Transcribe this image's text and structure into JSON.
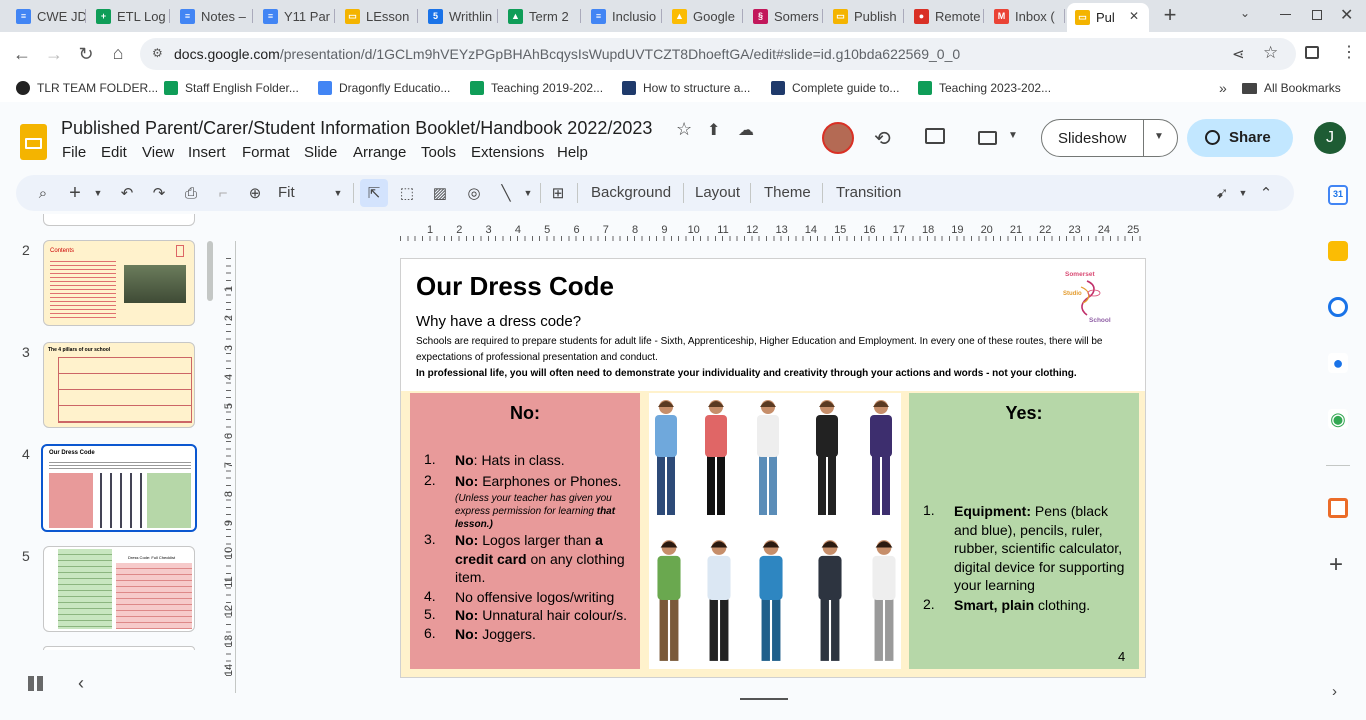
{
  "browser": {
    "tabs": [
      {
        "label": "CWE JD",
        "color": "#4285f4",
        "glyph": "≡"
      },
      {
        "label": "ETL Log",
        "color": "#0f9d58",
        "glyph": "+"
      },
      {
        "label": "Notes –",
        "color": "#4285f4",
        "glyph": "≡"
      },
      {
        "label": "Y11 Par",
        "color": "#4285f4",
        "glyph": "≡"
      },
      {
        "label": "LEsson",
        "color": "#f4b400",
        "glyph": "▭"
      },
      {
        "label": "Writhlin",
        "color": "#1a73e8",
        "glyph": "5"
      },
      {
        "label": "Term 2",
        "color": "#0f9d58",
        "glyph": "▲"
      },
      {
        "label": "Inclusio",
        "color": "#4285f4",
        "glyph": "≡"
      },
      {
        "label": "Google",
        "color": "#fbbc04",
        "glyph": "▲"
      },
      {
        "label": "Somers",
        "color": "#c2185b",
        "glyph": "§"
      },
      {
        "label": "Publish",
        "color": "#f4b400",
        "glyph": "▭"
      },
      {
        "label": "Remote",
        "color": "#d93025",
        "glyph": "●"
      },
      {
        "label": "Inbox (",
        "color": "#ea4335",
        "glyph": "M"
      },
      {
        "label": "Pul",
        "color": "#f4b400",
        "glyph": "▭"
      }
    ],
    "url_host": "docs.google.com",
    "url_path": "/presentation/d/1GCLm9hVEYzPGpBHAhBcqysIsWupdUVTCZT8DhoeftGA/edit#slide=id.g10bda622569_0_0",
    "bookmarks": [
      {
        "label": "TLR TEAM FOLDER...",
        "icon": "github-icon"
      },
      {
        "label": "Staff English Folder...",
        "icon": "drive-icon"
      },
      {
        "label": "Dragonfly Educatio...",
        "icon": "dragonfly-icon"
      },
      {
        "label": "Teaching 2019-202...",
        "icon": "drive-icon"
      },
      {
        "label": "How to structure a...",
        "icon": "tes-icon"
      },
      {
        "label": "Complete guide to...",
        "icon": "tes-icon"
      },
      {
        "label": "Teaching 2023-202...",
        "icon": "drive-icon"
      }
    ],
    "all_bookmarks": "All Bookmarks"
  },
  "app": {
    "title": "Published Parent/Carer/Student Information Booklet/Handbook 2022/2023",
    "menu": [
      "File",
      "Edit",
      "View",
      "Insert",
      "Format",
      "Slide",
      "Arrange",
      "Tools",
      "Extensions",
      "Help"
    ],
    "slideshow_label": "Slideshow",
    "share_label": "Share",
    "avatar_letter": "J"
  },
  "toolbar": {
    "zoom": "Fit",
    "background": "Background",
    "layout": "Layout",
    "theme": "Theme",
    "transition": "Transition"
  },
  "filmstrip": {
    "numbers": [
      "2",
      "3",
      "4",
      "5"
    ],
    "selected": "4",
    "thumb2_title": "Contents",
    "thumb3_title": "The 4 pillars of our school",
    "thumb4_title": "Our Dress Code",
    "thumb5_title": "Dress Code: Full Checklist"
  },
  "ruler": {
    "h": [
      "1",
      "2",
      "3",
      "4",
      "5",
      "6",
      "7",
      "8",
      "9",
      "10",
      "11",
      "12",
      "13",
      "14",
      "15",
      "16",
      "17",
      "18",
      "19",
      "20",
      "21",
      "22",
      "23",
      "24",
      "25"
    ],
    "v": [
      "1",
      "2",
      "3",
      "4",
      "5",
      "6",
      "7",
      "8",
      "9",
      "10",
      "11",
      "12",
      "13",
      "14"
    ]
  },
  "slide": {
    "title": "Our Dress Code",
    "subtitle": "Why have a dress code?",
    "para1": "Schools are required to prepare students for adult life - Sixth, Apprenticeship, Higher Education and Employment. In every one of these routes, there will be expectations of professional presentation and conduct.",
    "para2": "In professional life, you will often need to demonstrate your individuality and creativity through your actions and words - not your clothing.",
    "logo_lines": [
      "Somerset",
      "Studio",
      "School"
    ],
    "no_heading": "No:",
    "yes_heading": "Yes:",
    "no_items": [
      {
        "num": "1.",
        "bold": "No",
        "text": ": Hats in class."
      },
      {
        "num": "2.",
        "bold": "No:",
        "text": " Earphones or Phones."
      },
      {
        "num": "3.",
        "bold": "No:",
        "text": " Logos larger than "
      },
      {
        "num": "4.",
        "bold": "",
        "text": "No offensive logos/writing"
      },
      {
        "num": "5.",
        "bold": "No:",
        "text": " Unnatural hair colour/s."
      },
      {
        "num": "6.",
        "bold": "No:",
        "text": " Joggers."
      }
    ],
    "no_item2_note_a": "(Unless your teacher has given you express permission for learning",
    "no_item2_note_b": "that lesson.)",
    "no_item3_bold": "a credit card",
    "no_item3_tail": " on any clothing item.",
    "yes_items": [
      {
        "num": "1.",
        "bold": "Equipment:",
        "text": " Pens (black and blue), pencils, ruler, rubber, scientific calculator, digital device for supporting your learning"
      },
      {
        "num": "2.",
        "bold": "Smart, plain",
        "text": " clothing."
      }
    ],
    "page_number": "4"
  }
}
